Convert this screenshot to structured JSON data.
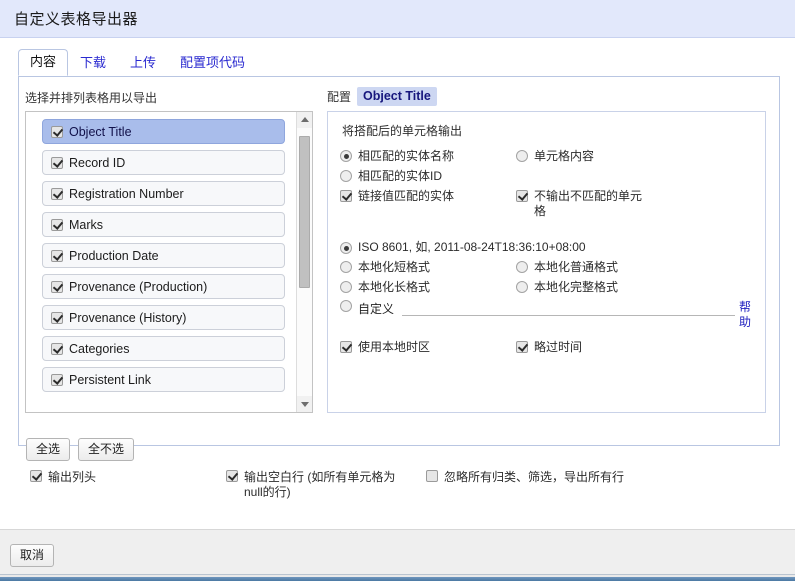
{
  "window": {
    "title": "自定义表格导出器"
  },
  "tabs": [
    {
      "label": "内容",
      "active": true
    },
    {
      "label": "下载",
      "active": false
    },
    {
      "label": "上传",
      "active": false
    },
    {
      "label": "配置项代码",
      "active": false
    }
  ],
  "left_panel": {
    "label": "选择并排列表格用以导出",
    "items": [
      {
        "label": "Object Title",
        "checked": true,
        "selected": true
      },
      {
        "label": "Record ID",
        "checked": true,
        "selected": false
      },
      {
        "label": "Registration Number",
        "checked": true,
        "selected": false
      },
      {
        "label": "Marks",
        "checked": true,
        "selected": false
      },
      {
        "label": "Production Date",
        "checked": true,
        "selected": false
      },
      {
        "label": "Provenance (Production)",
        "checked": true,
        "selected": false
      },
      {
        "label": "Provenance (History)",
        "checked": true,
        "selected": false
      },
      {
        "label": "Categories",
        "checked": true,
        "selected": false
      },
      {
        "label": "Persistent Link",
        "checked": true,
        "selected": false
      }
    ],
    "buttons": {
      "select_all": "全选",
      "select_none": "全不选"
    },
    "scrollbar": {
      "up_icon": "triangle-up-icon",
      "down_icon": "triangle-down-icon"
    }
  },
  "right_panel": {
    "label": "配置",
    "field_name": "Object Title",
    "heading": "将搭配后的单元格输出",
    "match_options": [
      {
        "label": "相匹配的实体名称",
        "type": "radio",
        "checked": true
      },
      {
        "label": "单元格内容",
        "type": "radio",
        "checked": false
      },
      {
        "label": "相匹配的实体ID",
        "type": "radio",
        "checked": false
      },
      {
        "label": "链接值匹配的实体",
        "type": "checkbox",
        "checked": true
      },
      {
        "label": "不输出不匹配的单元格",
        "type": "checkbox",
        "checked": true
      }
    ],
    "date_options": [
      {
        "label": "ISO 8601, 如, 2011-08-24T18:36:10+08:00",
        "checked": true
      },
      {
        "label": "本地化短格式",
        "checked": false
      },
      {
        "label": "本地化普通格式",
        "checked": false
      },
      {
        "label": "本地化长格式",
        "checked": false
      },
      {
        "label": "本地化完整格式",
        "checked": false
      },
      {
        "label": "自定义",
        "checked": false
      }
    ],
    "custom_format": {
      "value": "",
      "placeholder": "",
      "help_label": "帮助"
    },
    "date_checkboxes": [
      {
        "label": "使用本地时区",
        "checked": true
      },
      {
        "label": "略过时间",
        "checked": true
      }
    ]
  },
  "bottom_options": [
    {
      "label": "输出列头",
      "checked": true
    },
    {
      "label": "输出空白行 (如所有单元格为 null的行)",
      "checked": true
    },
    {
      "label": "忽略所有归类、筛选，导出所有行",
      "checked": false
    }
  ],
  "footer": {
    "cancel_label": "取消"
  },
  "colors": {
    "titlebar_bg": "#e2e8fb",
    "selection_bg": "#a9bdeb",
    "chip_bg": "#cdd7f2",
    "link": "#2a2ad0",
    "panel_border": "#b9c6e2"
  }
}
